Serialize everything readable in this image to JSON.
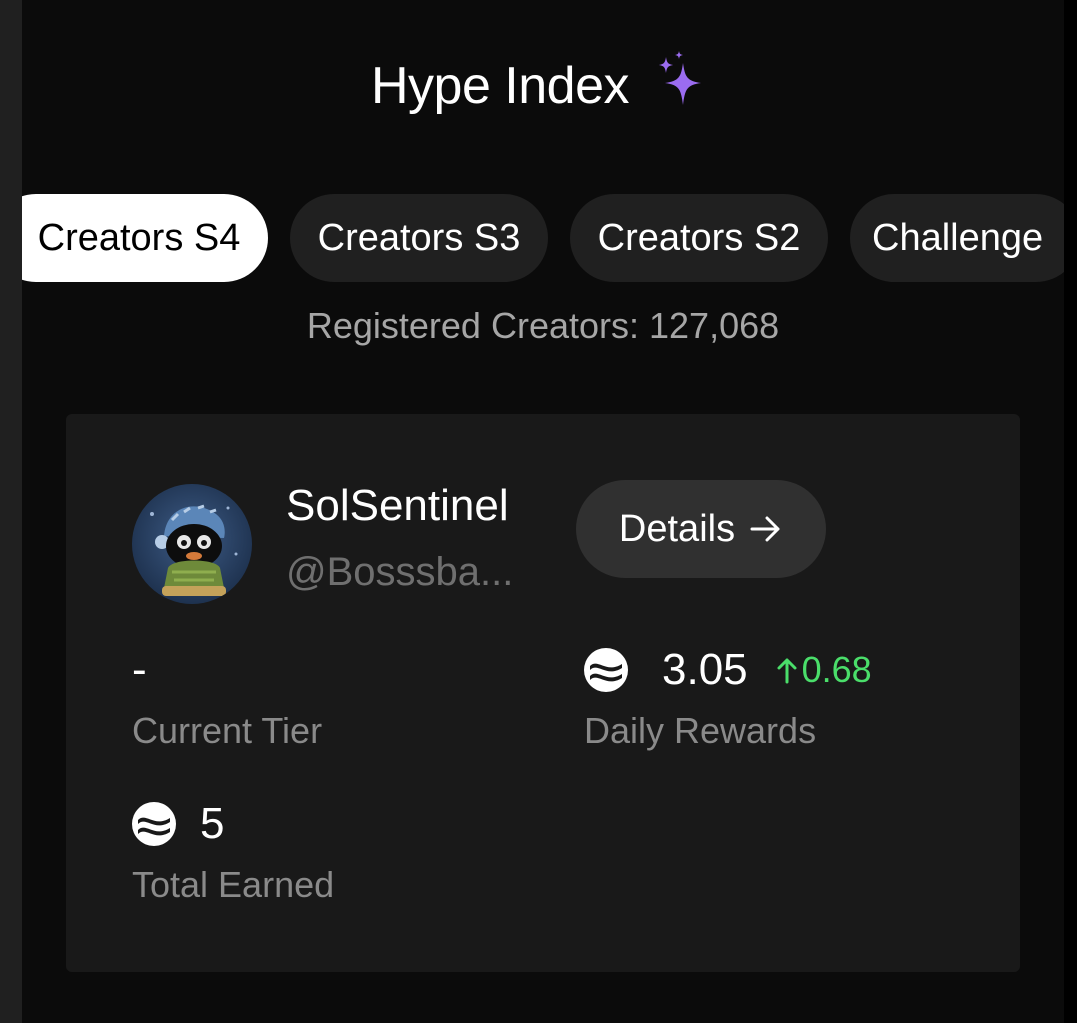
{
  "header": {
    "title": "Hype Index",
    "title_icon": "sparkle-icon",
    "accent_color": "#9b6cf0"
  },
  "tabs": [
    {
      "label": "Creators S4",
      "active": true
    },
    {
      "label": "Creators S3",
      "active": false
    },
    {
      "label": "Creators S2",
      "active": false
    },
    {
      "label": "Challenge",
      "active": false
    }
  ],
  "registered_text": "Registered Creators: 127,068",
  "profile": {
    "name": "SolSentinel",
    "handle": "@Bosssba...",
    "details_label": "Details",
    "details_icon": "arrow-right-icon"
  },
  "stats": {
    "current_tier": {
      "value": "-",
      "label": "Current Tier"
    },
    "daily_rewards": {
      "value": "3.05",
      "delta": "0.68",
      "delta_direction": "up",
      "delta_color": "#4ade6a",
      "label": "Daily Rewards",
      "icon": "sui-coin-icon"
    },
    "total_earned": {
      "value": "5",
      "label": "Total Earned",
      "icon": "sui-coin-icon"
    }
  }
}
